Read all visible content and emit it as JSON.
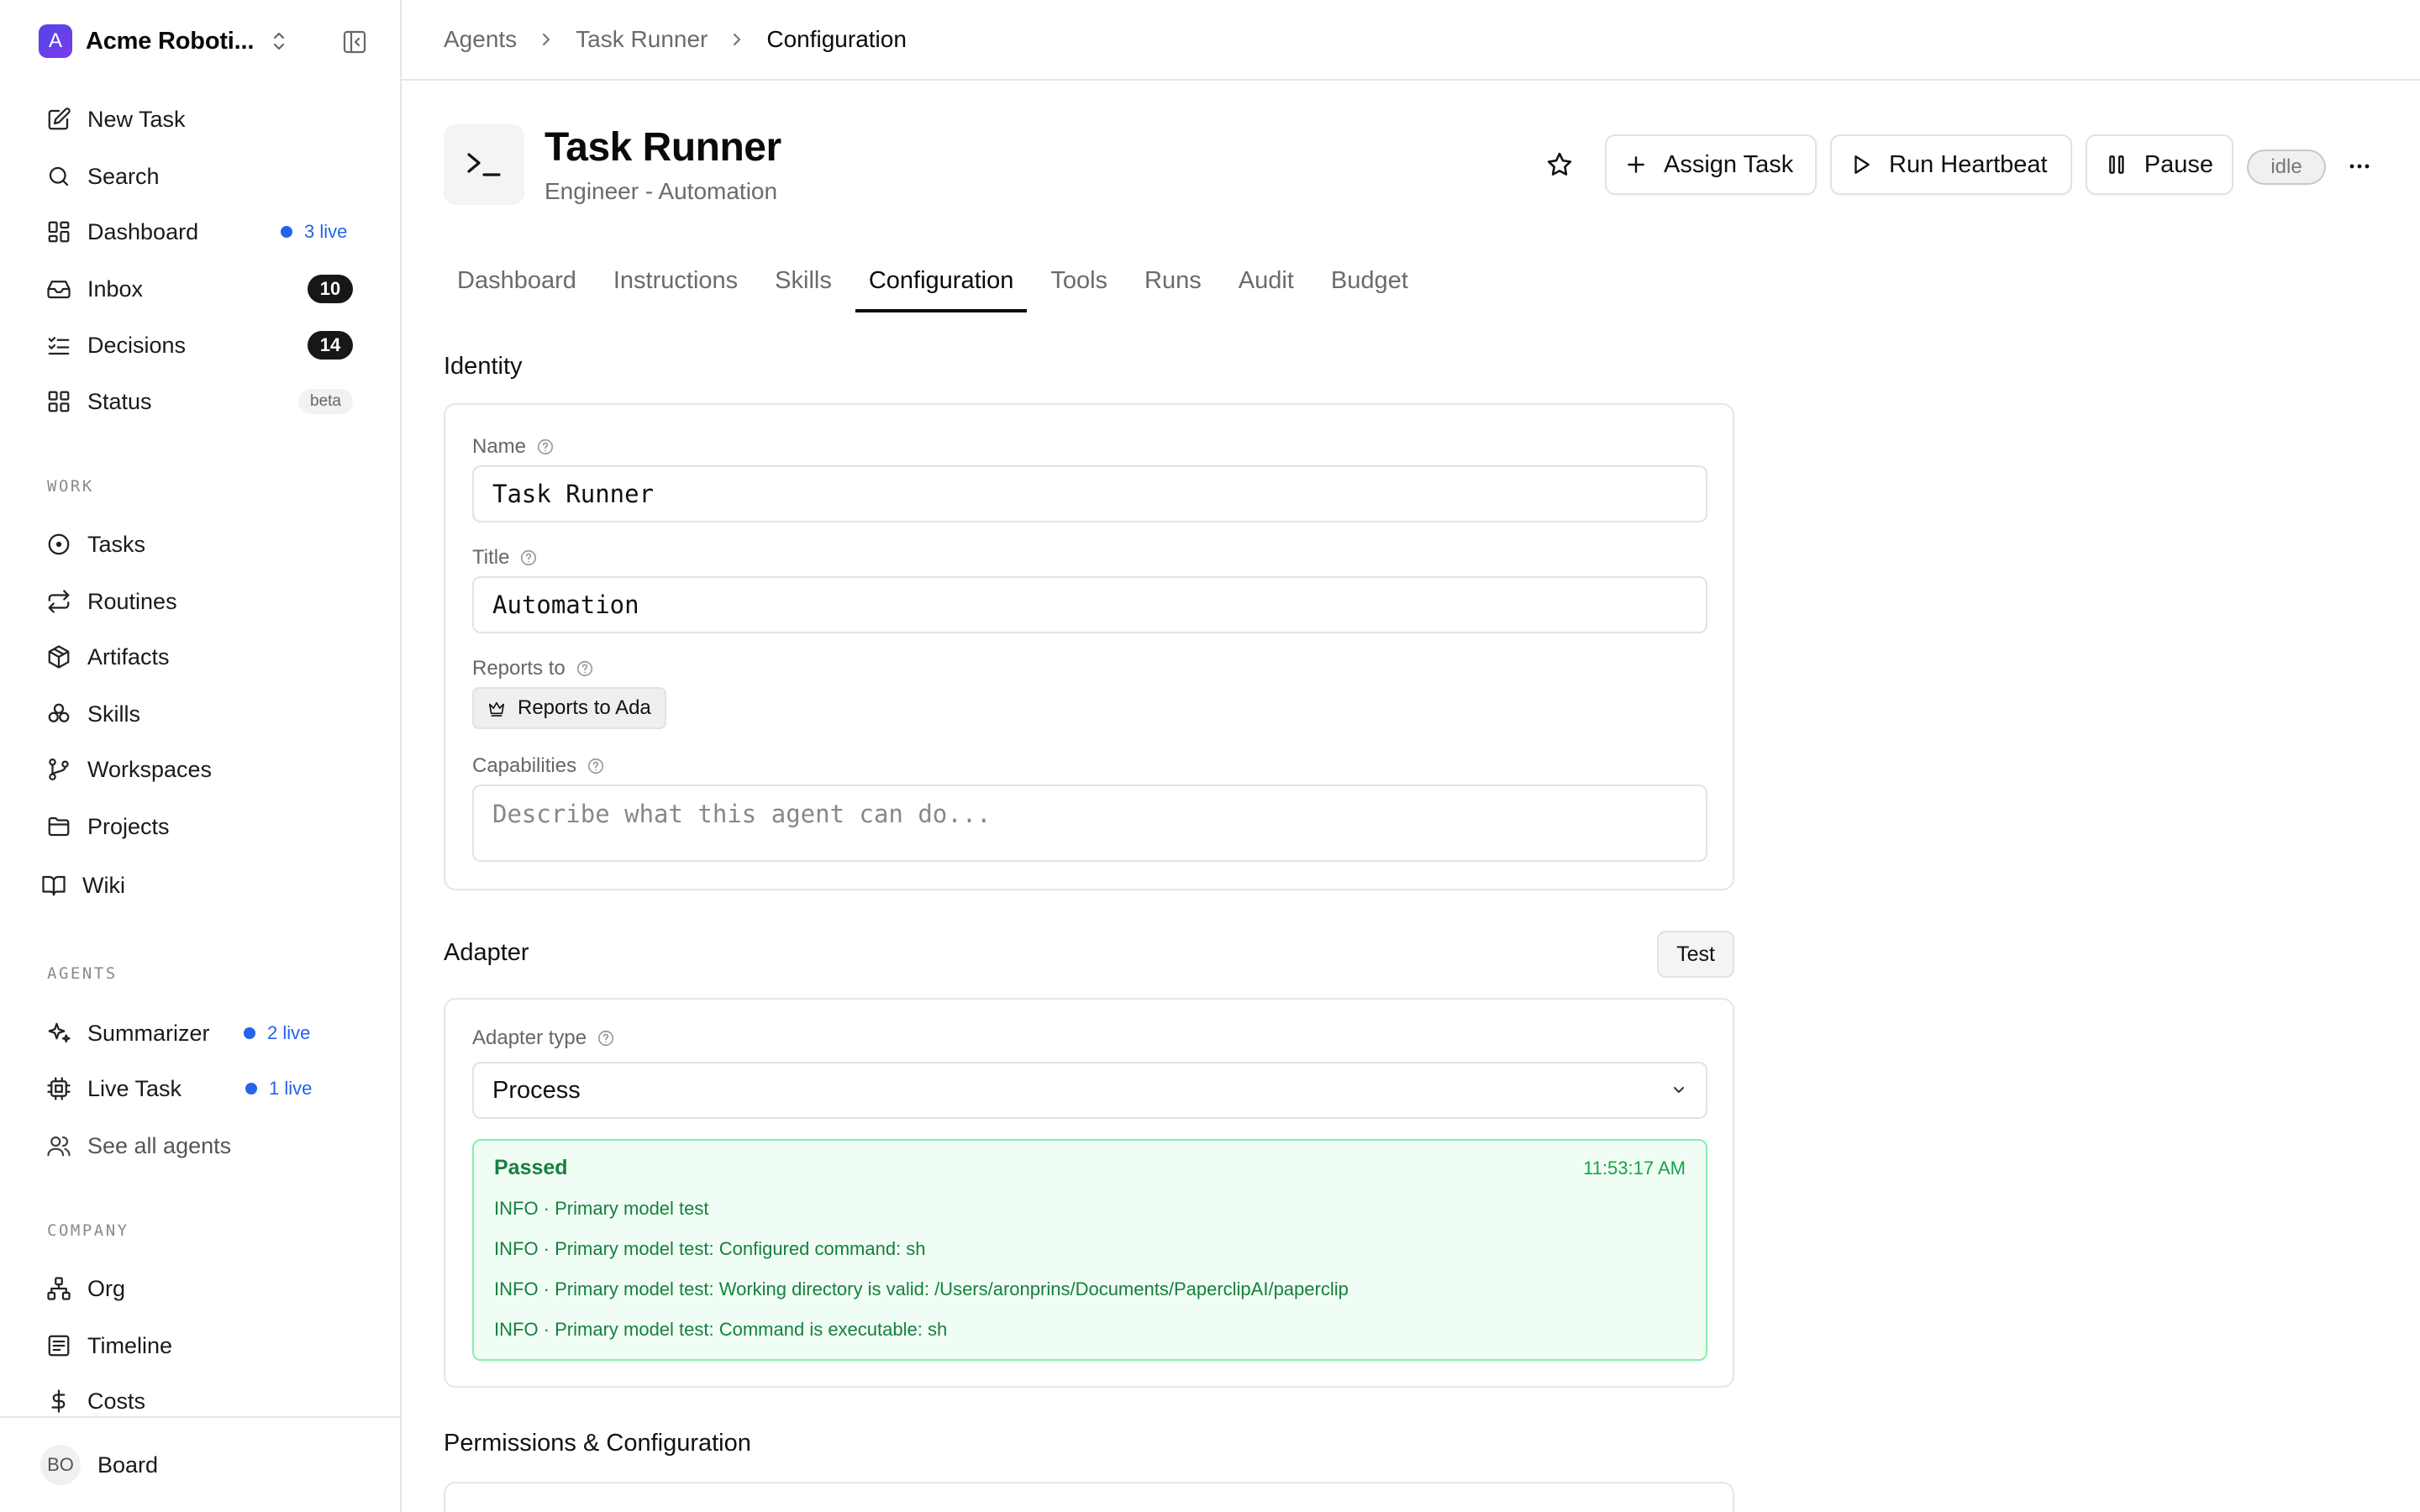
{
  "workspace": {
    "logo_letter": "A",
    "name": "Acme Roboti..."
  },
  "nav": {
    "top": [
      {
        "label": "New Task",
        "icon": "pencil-square-icon"
      },
      {
        "label": "Search",
        "icon": "search-icon"
      },
      {
        "label": "Dashboard",
        "icon": "grid-icon",
        "live": "3 live"
      },
      {
        "label": "Inbox",
        "icon": "inbox-icon",
        "count": "10"
      },
      {
        "label": "Decisions",
        "icon": "list-check-icon",
        "count": "14"
      },
      {
        "label": "Status",
        "icon": "grid-icon",
        "badge": "beta"
      }
    ],
    "work_label": "WORK",
    "work": [
      {
        "label": "Tasks",
        "icon": "circle-dot-icon"
      },
      {
        "label": "Routines",
        "icon": "repeat-icon"
      },
      {
        "label": "Artifacts",
        "icon": "package-icon"
      },
      {
        "label": "Skills",
        "icon": "boxes-icon"
      },
      {
        "label": "Workspaces",
        "icon": "git-branch-icon"
      },
      {
        "label": "Projects",
        "icon": "folder-icon"
      },
      {
        "label": "Wiki",
        "icon": "book-icon"
      }
    ],
    "agents_label": "AGENTS",
    "agents": [
      {
        "label": "Summarizer",
        "icon": "sparkles-icon",
        "live": "2 live"
      },
      {
        "label": "Live Task",
        "icon": "cpu-icon",
        "live": "1 live"
      },
      {
        "label": "See all agents",
        "icon": "users-icon"
      }
    ],
    "company_label": "COMPANY",
    "company": [
      {
        "label": "Org",
        "icon": "org-chart-icon"
      },
      {
        "label": "Timeline",
        "icon": "timeline-icon"
      },
      {
        "label": "Costs",
        "icon": "dollar-icon"
      }
    ]
  },
  "footer": {
    "initials": "BO",
    "name": "Board"
  },
  "breadcrumb": [
    "Agents",
    "Task Runner",
    "Configuration"
  ],
  "agent": {
    "name": "Task Runner",
    "subtitle": "Engineer - Automation",
    "status": "idle",
    "actions": {
      "assign": "Assign Task",
      "heartbeat": "Run Heartbeat",
      "pause": "Pause"
    }
  },
  "tabs": [
    "Dashboard",
    "Instructions",
    "Skills",
    "Configuration",
    "Tools",
    "Runs",
    "Audit",
    "Budget"
  ],
  "active_tab": "Configuration",
  "identity": {
    "title": "Identity",
    "name_label": "Name",
    "name_value": "Task Runner",
    "title_label": "Title",
    "title_value": "Automation",
    "reports_label": "Reports to",
    "reports_value": "Reports to Ada",
    "capabilities_label": "Capabilities",
    "capabilities_placeholder": "Describe what this agent can do..."
  },
  "adapter": {
    "title": "Adapter",
    "test_label": "Test",
    "type_label": "Adapter type",
    "type_value": "Process",
    "result": {
      "status": "Passed",
      "time": "11:53:17 AM",
      "logs": [
        {
          "level": "INFO",
          "message": "Primary model test"
        },
        {
          "level": "INFO",
          "message": "Primary model test: Configured command: sh"
        },
        {
          "level": "INFO",
          "message": "Primary model test: Working directory is valid: /Users/aronprins/Documents/PaperclipAI/paperclip"
        },
        {
          "level": "INFO",
          "message": "Primary model test: Command is executable: sh"
        }
      ]
    }
  },
  "permissions": {
    "title": "Permissions & Configuration"
  },
  "colors": {
    "accent_blue": "#2563eb",
    "success_green": "#15803d",
    "success_bg": "#f0fdf4"
  }
}
